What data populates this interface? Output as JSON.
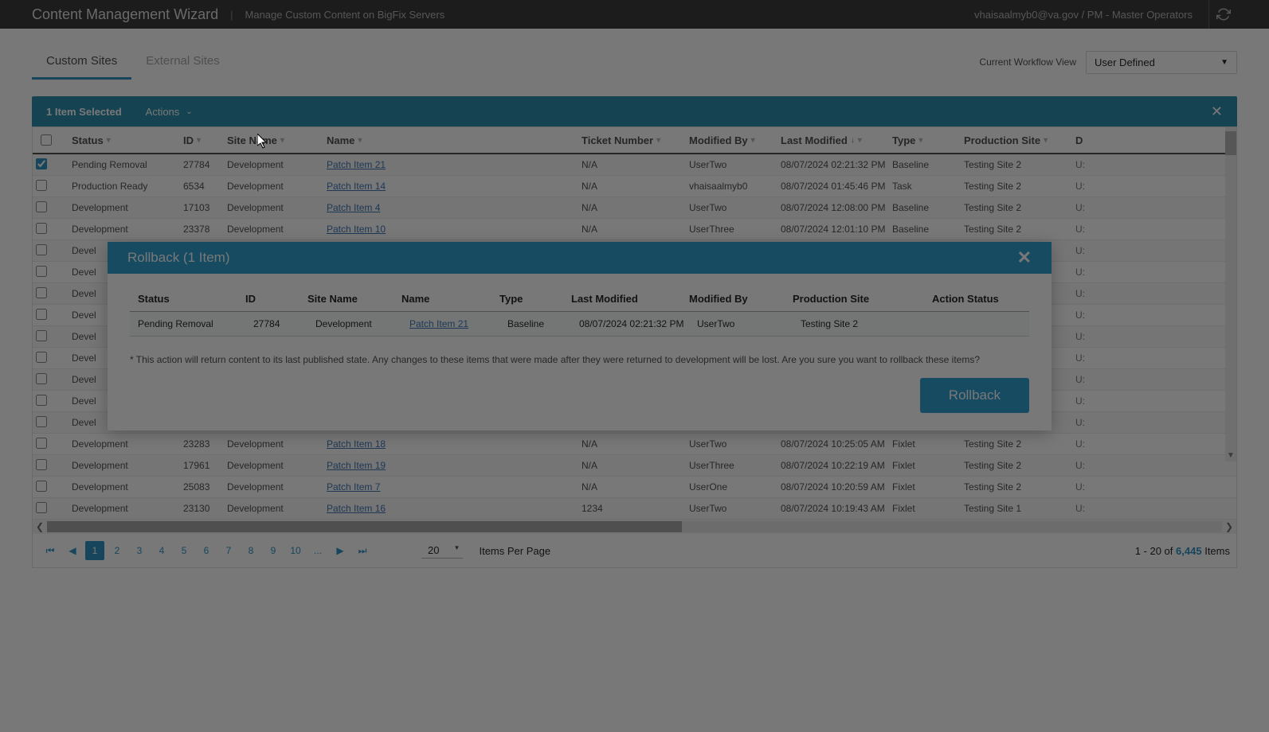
{
  "header": {
    "title": "Content Management Wizard",
    "subtitle": "Manage Custom Content on BigFix Servers",
    "user": "vhaisaalmyb0@va.gov / PM - Master Operators"
  },
  "tabs": {
    "custom": "Custom Sites",
    "external": "External Sites"
  },
  "workflow": {
    "label": "Current Workflow View",
    "value": "User Defined"
  },
  "selection_bar": {
    "count_text": "1 Item Selected",
    "actions": "Actions"
  },
  "columns": {
    "status": "Status",
    "id": "ID",
    "site_name": "Site Name",
    "name": "Name",
    "ticket": "Ticket Number",
    "modified_by": "Modified By",
    "last_modified": "Last Modified",
    "type": "Type",
    "production_site": "Production Site",
    "d": "D"
  },
  "rows": [
    {
      "checked": true,
      "status": "Pending Removal",
      "id": "27784",
      "site": "Development",
      "name": "Patch Item 21",
      "ticket": "N/A",
      "modby": "UserTwo",
      "lastmod": "08/07/2024 02:21:32 PM",
      "type": "Baseline",
      "prod": "Testing Site 2",
      "d": "U:"
    },
    {
      "checked": false,
      "status": "Production Ready",
      "id": "6534",
      "site": "Development",
      "name": "Patch Item 14",
      "ticket": "N/A",
      "modby": "vhaisaalmyb0",
      "lastmod": "08/07/2024 01:45:46 PM",
      "type": "Task",
      "prod": "Testing Site 2",
      "d": "U:"
    },
    {
      "checked": false,
      "status": "Development",
      "id": "17103",
      "site": "Development",
      "name": "Patch Item 4",
      "ticket": "N/A",
      "modby": "UserTwo",
      "lastmod": "08/07/2024 12:08:00 PM",
      "type": "Baseline",
      "prod": "Testing Site 2",
      "d": "U:"
    },
    {
      "checked": false,
      "status": "Development",
      "id": "23378",
      "site": "Development",
      "name": "Patch Item 10",
      "ticket": "N/A",
      "modby": "UserThree",
      "lastmod": "08/07/2024 12:01:10 PM",
      "type": "Baseline",
      "prod": "Testing Site 2",
      "d": "U:"
    },
    {
      "checked": false,
      "status": "Devel",
      "id": "",
      "site": "",
      "name": "",
      "ticket": "",
      "modby": "",
      "lastmod": "",
      "type": "",
      "prod": "",
      "d": "U:"
    },
    {
      "checked": false,
      "status": "Devel",
      "id": "",
      "site": "",
      "name": "",
      "ticket": "",
      "modby": "",
      "lastmod": "",
      "type": "",
      "prod": "",
      "d": "U:"
    },
    {
      "checked": false,
      "status": "Devel",
      "id": "",
      "site": "",
      "name": "",
      "ticket": "",
      "modby": "",
      "lastmod": "",
      "type": "",
      "prod": "",
      "d": "U:"
    },
    {
      "checked": false,
      "status": "Devel",
      "id": "",
      "site": "",
      "name": "",
      "ticket": "",
      "modby": "",
      "lastmod": "",
      "type": "",
      "prod": "",
      "d": "U:"
    },
    {
      "checked": false,
      "status": "Devel",
      "id": "",
      "site": "",
      "name": "",
      "ticket": "",
      "modby": "",
      "lastmod": "",
      "type": "",
      "prod": "",
      "d": "U:"
    },
    {
      "checked": false,
      "status": "Devel",
      "id": "",
      "site": "",
      "name": "",
      "ticket": "",
      "modby": "",
      "lastmod": "",
      "type": "",
      "prod": "",
      "d": "U:"
    },
    {
      "checked": false,
      "status": "Devel",
      "id": "",
      "site": "",
      "name": "",
      "ticket": "",
      "modby": "",
      "lastmod": "",
      "type": "",
      "prod": "",
      "d": "U:"
    },
    {
      "checked": false,
      "status": "Devel",
      "id": "",
      "site": "",
      "name": "",
      "ticket": "",
      "modby": "",
      "lastmod": "",
      "type": "",
      "prod": "",
      "d": "U:"
    },
    {
      "checked": false,
      "status": "Devel",
      "id": "",
      "site": "",
      "name": "",
      "ticket": "",
      "modby": "",
      "lastmod": "",
      "type": "",
      "prod": "",
      "d": "U:"
    },
    {
      "checked": false,
      "status": "Development",
      "id": "23283",
      "site": "Development",
      "name": "Patch Item 18",
      "ticket": "N/A",
      "modby": "UserTwo",
      "lastmod": "08/07/2024 10:25:05 AM",
      "type": "Fixlet",
      "prod": "Testing Site 2",
      "d": "U:"
    },
    {
      "checked": false,
      "status": "Development",
      "id": "17961",
      "site": "Development",
      "name": "Patch Item 19",
      "ticket": "N/A",
      "modby": "UserThree",
      "lastmod": "08/07/2024 10:22:19 AM",
      "type": "Fixlet",
      "prod": "Testing Site 2",
      "d": "U:"
    },
    {
      "checked": false,
      "status": "Development",
      "id": "25083",
      "site": "Development",
      "name": "Patch Item 7",
      "ticket": "N/A",
      "modby": "UserOne",
      "lastmod": "08/07/2024 10:20:59 AM",
      "type": "Fixlet",
      "prod": "Testing Site 2",
      "d": "U:"
    },
    {
      "checked": false,
      "status": "Development",
      "id": "23130",
      "site": "Development",
      "name": "Patch Item 16",
      "ticket": "1234",
      "modby": "UserTwo",
      "lastmod": "08/07/2024 10:19:43 AM",
      "type": "Fixlet",
      "prod": "Testing Site 1",
      "d": "U:"
    }
  ],
  "pagination": {
    "pages": [
      "1",
      "2",
      "3",
      "4",
      "5",
      "6",
      "7",
      "8",
      "9",
      "10",
      "..."
    ],
    "active": "1",
    "page_size": "20",
    "items_per_page_label": "Items Per Page",
    "range": "1 - 20 of",
    "total": "6,445",
    "items_label": "Items"
  },
  "modal": {
    "title": "Rollback (1 Item)",
    "columns": {
      "status": "Status",
      "id": "ID",
      "site_name": "Site Name",
      "name": "Name",
      "type": "Type",
      "last_modified": "Last Modified",
      "modified_by": "Modified By",
      "production_site": "Production Site",
      "action_status": "Action Status"
    },
    "row": {
      "status": "Pending Removal",
      "id": "27784",
      "site": "Development",
      "name": "Patch Item 21",
      "type": "Baseline",
      "lastmod": "08/07/2024 02:21:32 PM",
      "modby": "UserTwo",
      "prod": "Testing Site 2",
      "action": ""
    },
    "note": "* This action will return content to its last published state. Any changes to these items that were made after they were returned to development will be lost. Are you sure you want to rollback these items?",
    "button": "Rollback"
  }
}
